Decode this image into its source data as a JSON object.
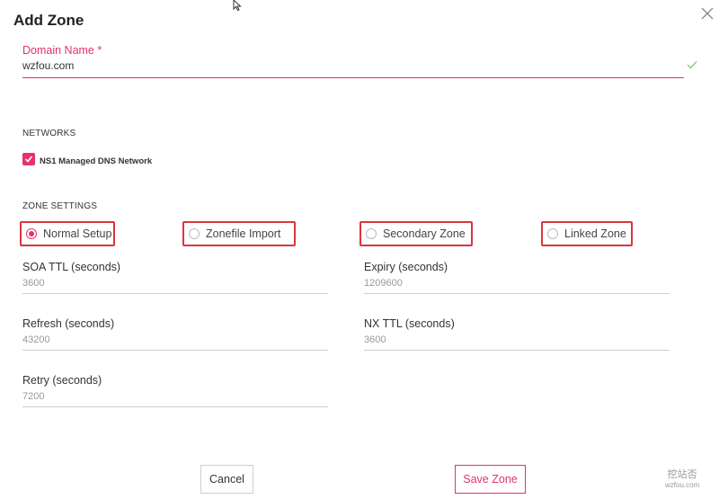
{
  "dialog": {
    "title": "Add Zone"
  },
  "domain": {
    "label": "Domain Name *",
    "value": "wzfou.com"
  },
  "networks": {
    "heading": "NETWORKS",
    "option": {
      "label": "NS1 Managed DNS Network",
      "checked": true
    }
  },
  "zone_settings": {
    "heading": "ZONE SETTINGS",
    "options": [
      {
        "label": "Normal Setup",
        "checked": true
      },
      {
        "label": "Zonefile Import",
        "checked": false
      },
      {
        "label": "Secondary Zone",
        "checked": false
      },
      {
        "label": "Linked Zone",
        "checked": false
      }
    ]
  },
  "fields": {
    "soa_ttl": {
      "label": "SOA TTL (seconds)",
      "value": "3600"
    },
    "expiry": {
      "label": "Expiry (seconds)",
      "value": "1209600"
    },
    "refresh": {
      "label": "Refresh (seconds)",
      "value": "43200"
    },
    "nx_ttl": {
      "label": "NX TTL (seconds)",
      "value": "3600"
    },
    "retry": {
      "label": "Retry (seconds)",
      "value": "7200"
    }
  },
  "buttons": {
    "cancel": "Cancel",
    "save": "Save Zone"
  },
  "watermark": {
    "line1": "挖站否",
    "line2": "wzfou.com"
  },
  "colors": {
    "accent": "#e5316f",
    "highlight_border": "#d9363e",
    "check": "#7ccf8a"
  },
  "icons": {
    "close": "close-icon",
    "valid": "check-icon",
    "pointer": "cursor-icon"
  }
}
